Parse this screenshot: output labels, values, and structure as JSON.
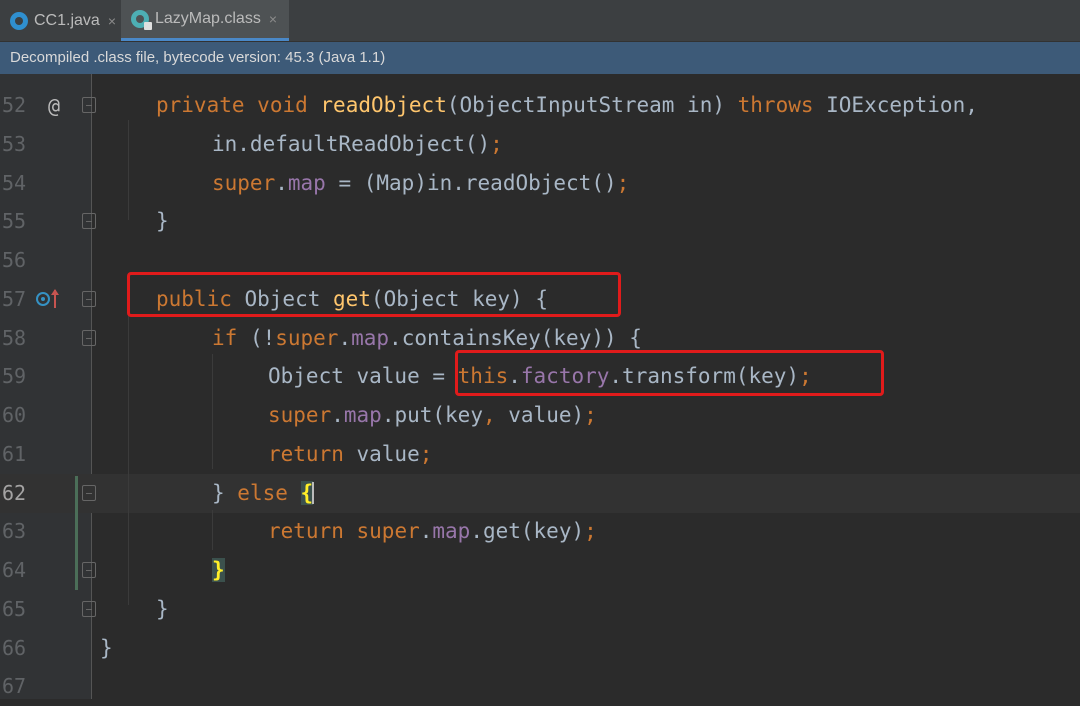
{
  "tabs": [
    {
      "label": "CC1.java",
      "close": "×"
    },
    {
      "label": "LazyMap.class",
      "close": "×"
    }
  ],
  "infobar": {
    "text": "Decompiled .class file, bytecode version: 45.3 (Java 1.1)"
  },
  "gutter": {
    "at_marker": "@"
  },
  "lines": {
    "52": {
      "num": "52",
      "t1": "private",
      "t2": " ",
      "t3": "void",
      "t4": " ",
      "t5": "readObject",
      "t6": "(ObjectInputStream in) ",
      "t7": "throws",
      "t8": " IOException,"
    },
    "53": {
      "num": "53",
      "t1": "in.defaultReadObject()",
      "t2": ";"
    },
    "54": {
      "num": "54",
      "t1": "super",
      "t2": ".",
      "t3": "map",
      "t4": " = (Map)in.readObject()",
      "t5": ";"
    },
    "55": {
      "num": "55",
      "t1": "}"
    },
    "56": {
      "num": "56"
    },
    "57": {
      "num": "57",
      "t1": "public",
      "t2": " Object ",
      "t3": "get",
      "t4": "(Object key) {"
    },
    "58": {
      "num": "58",
      "t1": "if",
      "t2": " (!",
      "t3": "super",
      "t4": ".",
      "t5": "map",
      "t6": ".containsKey(key)) {"
    },
    "59": {
      "num": "59",
      "t1": "Object value = ",
      "t2": "this",
      "t3": ".",
      "t4": "factory",
      "t5": ".transform(key)",
      "t6": ";"
    },
    "60": {
      "num": "60",
      "t1": "super",
      "t2": ".",
      "t3": "map",
      "t4": ".put(key",
      "t5": ",",
      "t6": " value)",
      "t7": ";"
    },
    "61": {
      "num": "61",
      "t1": "return",
      "t2": " value",
      "t3": ";"
    },
    "62": {
      "num": "62",
      "t1": "} ",
      "t2": "else",
      "t3": " ",
      "t4": "{"
    },
    "63": {
      "num": "63",
      "t1": "return",
      "t2": " ",
      "t3": "super",
      "t4": ".",
      "t5": "map",
      "t6": ".get(key)",
      "t7": ";"
    },
    "64": {
      "num": "64",
      "t1": "}"
    },
    "65": {
      "num": "65",
      "t1": "}"
    },
    "66": {
      "num": "66",
      "t1": "}"
    },
    "67": {
      "num": "67"
    }
  },
  "colors": {
    "keyword": "#cc7832",
    "method": "#ffc66d",
    "field": "#9876aa",
    "text": "#a9b7c6",
    "highlight_box": "#e01b1b"
  }
}
